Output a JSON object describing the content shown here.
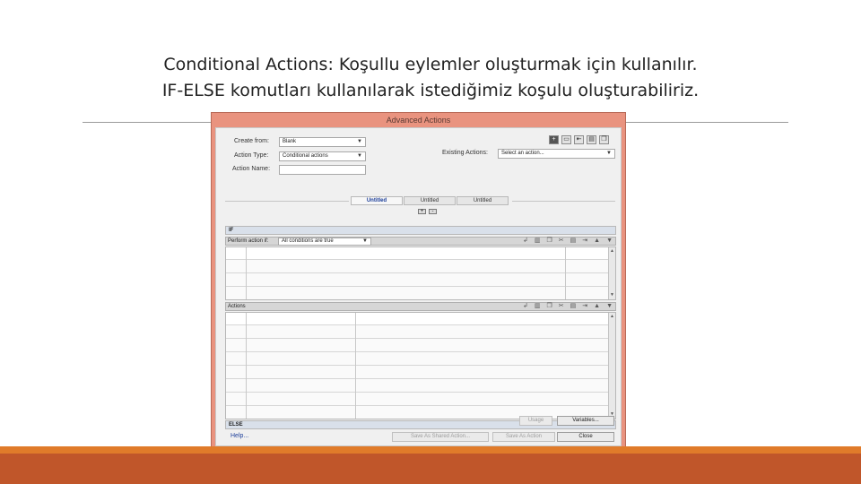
{
  "slide": {
    "title_line1": "Conditional Actions: Koşullu eylemler oluşturmak için kullanılır.",
    "title_line2": "IF-ELSE komutları kullanılarak istediğimiz koşulu oluşturabiliriz."
  },
  "dialog": {
    "title": "Advanced Actions",
    "create_from_label": "Create from:",
    "create_from_value": "Blank",
    "action_type_label": "Action Type:",
    "action_type_value": "Conditional actions",
    "action_name_label": "Action Name:",
    "action_name_value": "",
    "existing_actions_label": "Existing Actions:",
    "existing_actions_value": "Select an action...",
    "toolbar_icons": [
      "add-icon",
      "image-icon",
      "import-icon",
      "delete-icon",
      "copy-icon"
    ],
    "tabs": [
      "Untitled",
      "Untitled",
      "Untitled"
    ],
    "active_tab": 0,
    "tab_add": "+",
    "tab_remove": "-",
    "if_header": "IF",
    "perform_label": "Perform action if:",
    "perform_value": "All conditions are true",
    "actions_label": "Actions",
    "else_header": "ELSE",
    "usage_label": "Usage",
    "variables_label": "Variables...",
    "help_label": "Help...",
    "save_shared_label": "Save As Shared Action...",
    "save_action_label": "Save As Action",
    "close_label": "Close",
    "grid_icons": [
      "insert-icon",
      "trash-icon",
      "copy-icon",
      "cut-icon",
      "paste-icon",
      "insert-row-icon",
      "move-up-icon",
      "move-down-icon"
    ]
  },
  "colors": {
    "dialog_frame": "#e9937f",
    "bottom_band_top": "#e07b2a",
    "bottom_band_bottom": "#c0562a",
    "active_tab_text": "#1d3f9a"
  }
}
